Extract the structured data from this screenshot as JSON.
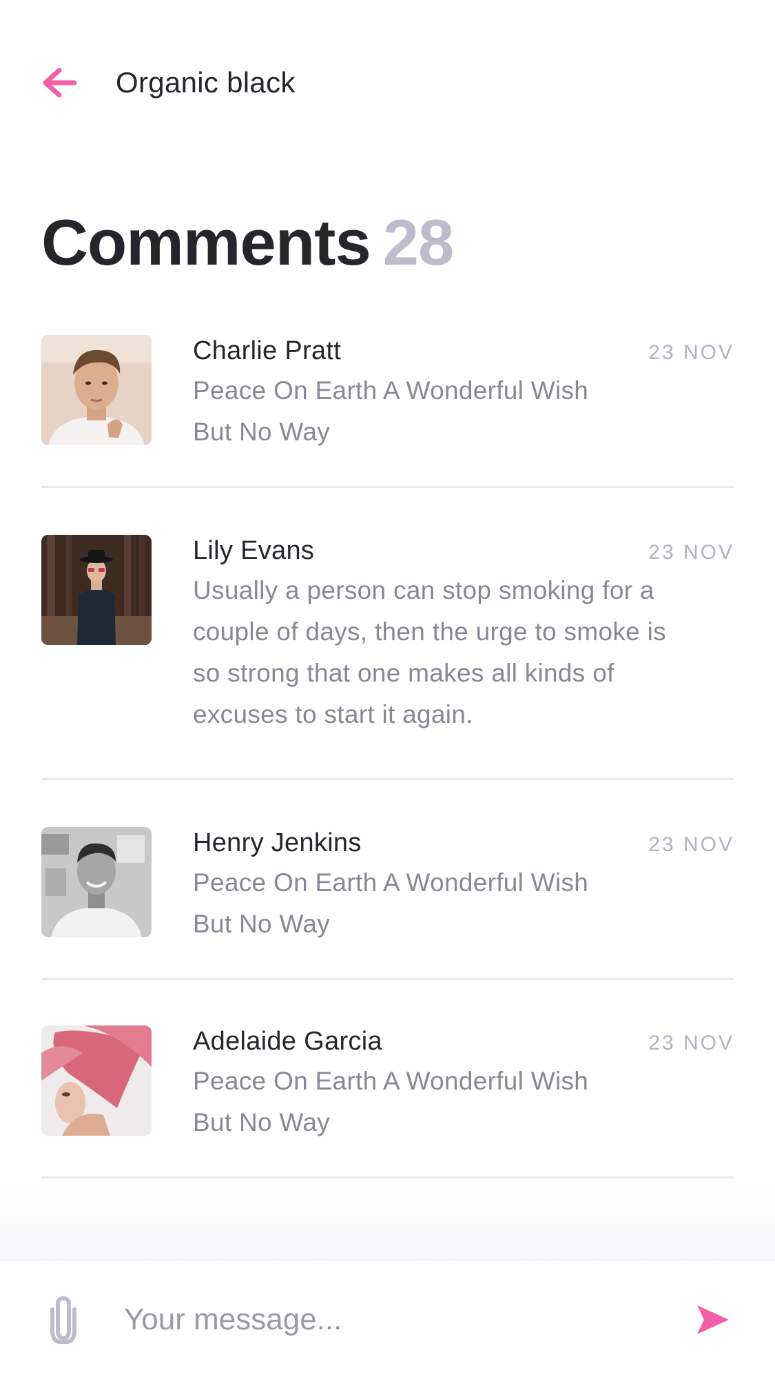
{
  "header": {
    "back_icon": "arrow-left-icon",
    "title": "Organic black"
  },
  "heading": {
    "label": "Comments",
    "count": "28"
  },
  "comments": [
    {
      "name": "Charlie Pratt",
      "date": "23 NOV",
      "text_lines": [
        "Peace On Earth A Wonderful Wish",
        "But No Way"
      ]
    },
    {
      "name": "Lily Evans",
      "date": "23 NOV",
      "text_lines": [
        "Usually a person can stop smoking for a",
        "couple of days, then the urge to smoke is",
        "so strong that one makes all kinds of",
        "excuses to start it again."
      ]
    },
    {
      "name": "Henry Jenkins",
      "date": "23 NOV",
      "text_lines": [
        "Peace On Earth A Wonderful Wish",
        "But No Way"
      ]
    },
    {
      "name": "Adelaide Garcia",
      "date": "23 NOV",
      "text_lines": [
        "Peace On Earth A Wonderful Wish",
        "But No Way"
      ]
    }
  ],
  "composer": {
    "attach_icon": "paperclip-icon",
    "placeholder": "Your message...",
    "value": "",
    "send_icon": "send-icon"
  },
  "colors": {
    "accent": "#f25fa5",
    "text_dark": "#26252b",
    "text_muted": "#898794",
    "count": "#bdbccd",
    "divider": "#e8e8ee"
  }
}
